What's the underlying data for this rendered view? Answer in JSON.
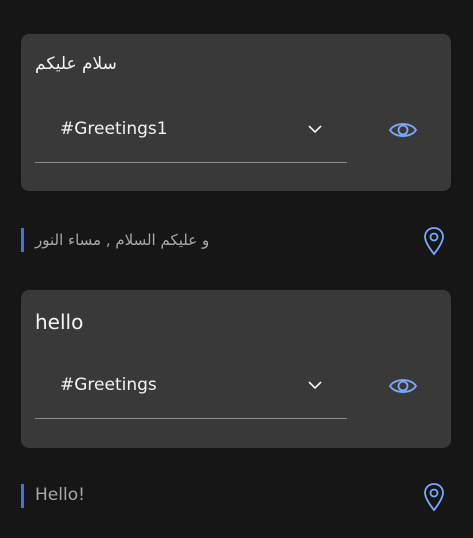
{
  "items": [
    {
      "card_title": "سلام عليكم",
      "select_value": "#Greetings1",
      "reply_text": "و عليكم السلام , مساء النور"
    },
    {
      "card_title": "hello",
      "select_value": "#Greetings",
      "reply_text": "Hello!"
    }
  ],
  "icons": {
    "select_arrow": "chevron-down-icon",
    "preview": "eye-icon",
    "location": "map-pin-icon"
  },
  "colors": {
    "background": "#161616",
    "card": "#393939",
    "accent": "#78a9ff",
    "reply_bar": "#4d72d6",
    "text": "#f4f4f4",
    "muted_text": "#a8a8a8"
  }
}
